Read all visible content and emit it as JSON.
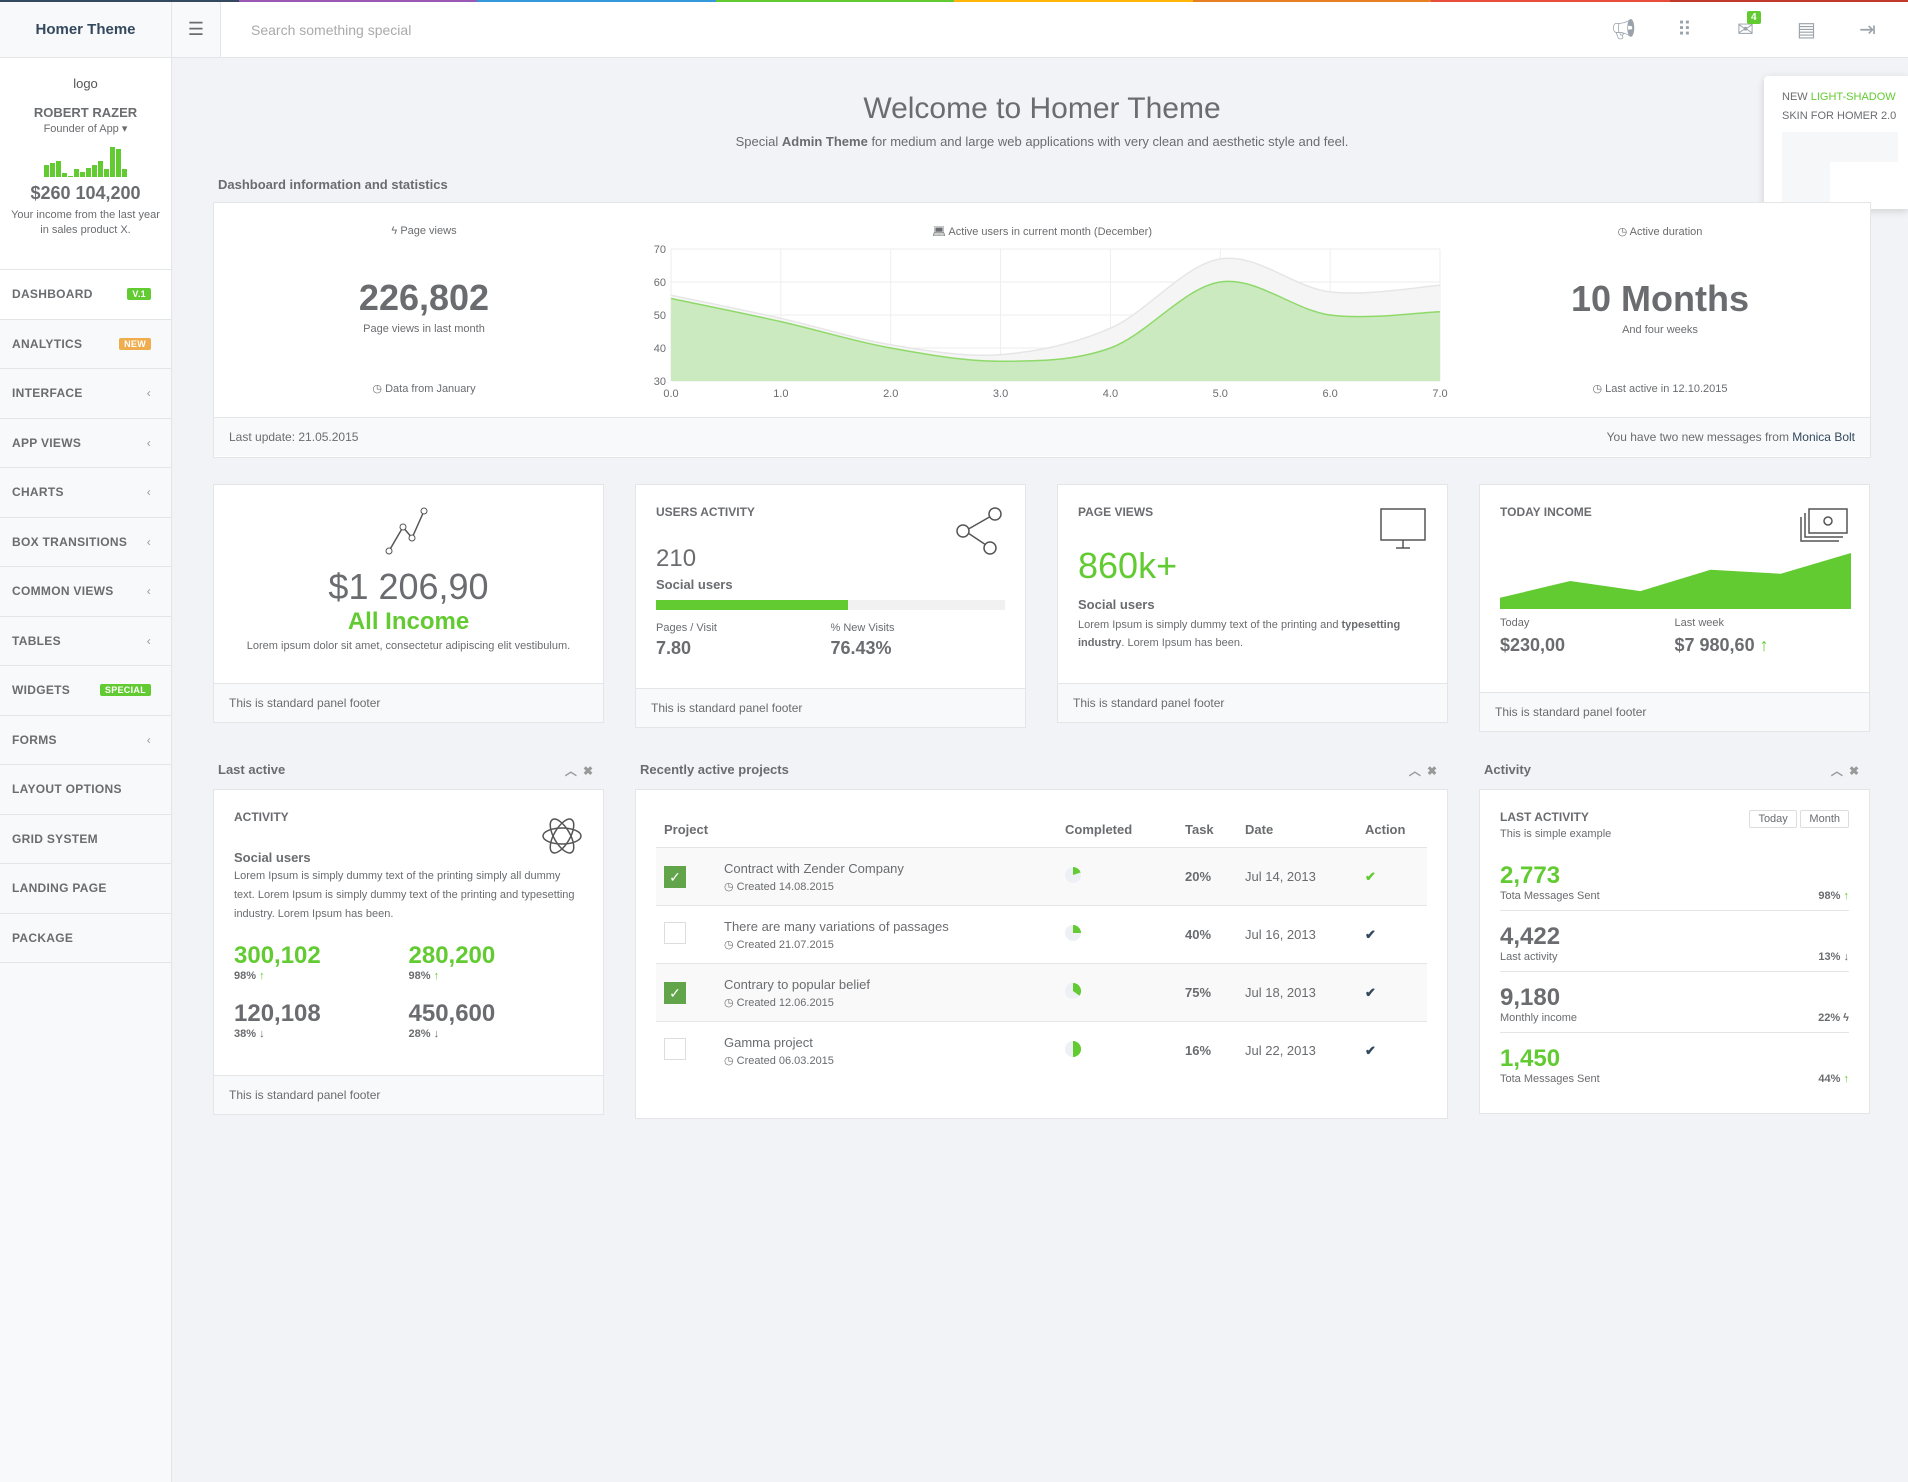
{
  "header": {
    "brand": "Homer Theme",
    "search_placeholder": "Search something special",
    "mail_count": "4",
    "stripe_colors": [
      "#34495e",
      "#9b59b6",
      "#3498db",
      "#62cb31",
      "#ffb606",
      "#e67e22",
      "#e74c3c",
      "#c0392b"
    ]
  },
  "profile": {
    "logo_alt": "logo",
    "name": "ROBERT RAZER",
    "role": "Founder of App",
    "spark": [
      12,
      14,
      16,
      4,
      1,
      8,
      5,
      9,
      12,
      16,
      8,
      30,
      28,
      8
    ],
    "income": "$260 104,200",
    "desc": "Your income from the last year in sales product X."
  },
  "nav": [
    {
      "label": "DASHBOARD",
      "badge": "V.1",
      "badge_color": "#62cb31"
    },
    {
      "label": "ANALYTICS",
      "badge": "NEW",
      "badge_color": "#f0ad4e"
    },
    {
      "label": "INTERFACE",
      "chevron": "‹"
    },
    {
      "label": "APP VIEWS",
      "chevron": "‹"
    },
    {
      "label": "CHARTS",
      "chevron": "‹"
    },
    {
      "label": "BOX TRANSITIONS",
      "chevron": "‹"
    },
    {
      "label": "COMMON VIEWS",
      "chevron": "‹"
    },
    {
      "label": "TABLES",
      "chevron": "‹"
    },
    {
      "label": "WIDGETS",
      "badge": "SPECIAL",
      "badge_color": "#62cb31"
    },
    {
      "label": "FORMS",
      "chevron": "‹"
    },
    {
      "label": "LAYOUT OPTIONS"
    },
    {
      "label": "GRID SYSTEM"
    },
    {
      "label": "LANDING PAGE"
    },
    {
      "label": "PACKAGE"
    }
  ],
  "promo": {
    "line1_prefix": "NEW ",
    "line1_highlight": "LIGHT-SHADOW",
    "line2": "SKIN FOR HOMER 2.0"
  },
  "welcome": {
    "title": "Welcome to Homer Theme",
    "sub_pre": "Special ",
    "sub_bold": "Admin Theme",
    "sub_post": " for medium and large web applications with very clean and aesthetic style and feel."
  },
  "dashboard": {
    "section_title": "Dashboard information and statistics",
    "left": {
      "label": "Page views",
      "value": "226,802",
      "sub": "Page views in last month",
      "bottom": "Data from January"
    },
    "right": {
      "label": "Active duration",
      "value": "10 Months",
      "sub": "And four weeks",
      "bottom": "Last active in 12.10.2015"
    },
    "footer_left": "Last update: 21.05.2015",
    "footer_right_pre": "You have two new messages from ",
    "footer_right_name": "Monica Bolt"
  },
  "chart_data": {
    "type": "area",
    "title": "Active users in current month (December)",
    "xlim": [
      0,
      7
    ],
    "ylim": [
      30,
      70
    ],
    "xticks": [
      "0.0",
      "1.0",
      "2.0",
      "3.0",
      "4.0",
      "5.0",
      "6.0",
      "7.0"
    ],
    "yticks": [
      "30",
      "40",
      "50",
      "60",
      "70"
    ],
    "grid": true,
    "x": [
      0,
      1,
      2,
      3,
      4,
      5,
      6,
      7
    ],
    "series": [
      {
        "color": "#e8e8e8",
        "values": [
          56,
          49,
          41,
          38,
          46,
          67,
          57,
          59
        ]
      },
      {
        "color": "#62cb31",
        "values": [
          55,
          48,
          40,
          36,
          40,
          60,
          50,
          51
        ]
      }
    ]
  },
  "cards": {
    "income": {
      "value": "$1 206,90",
      "label": "All Income",
      "text": "Lorem ipsum dolor sit amet, consectetur adipiscing elit vestibulum.",
      "footer": "This is standard panel footer"
    },
    "users": {
      "title": "USERS ACTIVITY",
      "value": "210",
      "label": "Social users",
      "progress": 55,
      "l1": "Pages / Visit",
      "v1": "7.80",
      "l2": "% New Visits",
      "v2": "76.43%",
      "footer": "This is standard panel footer"
    },
    "pageviews": {
      "title": "PAGE VIEWS",
      "value": "860k+",
      "label": "Social users",
      "text_pre": "Lorem Ipsum is simply dummy text of the printing and ",
      "text_bold": "typesetting industry",
      "text_post": ". Lorem Ipsum has been.",
      "footer": "This is standard panel footer"
    },
    "today": {
      "title": "TODAY INCOME",
      "spark": [
        20,
        50,
        32,
        70,
        63,
        100
      ],
      "l1": "Today",
      "v1": "$230,00",
      "l2": "Last week",
      "v2": "$7 980,60",
      "footer": "This is standard panel footer"
    }
  },
  "last_active": {
    "heading": "Last active",
    "title": "ACTIVITY",
    "sub": "Social users",
    "text": "Lorem Ipsum is simply dummy text of the printing simply all dummy text. Lorem Ipsum is simply dummy text of the printing and typesetting industry. Lorem Ipsum has been.",
    "stats": [
      {
        "v": "300,102",
        "p": "98%",
        "dir": "up"
      },
      {
        "v": "280,200",
        "p": "98%",
        "dir": "up"
      },
      {
        "v": "120,108",
        "p": "38%",
        "dir": "down"
      },
      {
        "v": "450,600",
        "p": "28%",
        "dir": "down"
      }
    ],
    "footer": "This is standard panel footer"
  },
  "projects": {
    "heading": "Recently active projects",
    "columns": [
      "Project",
      "Completed",
      "Task",
      "Date",
      "Action"
    ],
    "rows": [
      {
        "checked": true,
        "name": "Contract with Zender Company",
        "created": "Created 14.08.2015",
        "pie": 20,
        "task": "20%",
        "date": "Jul 14, 2013",
        "action_color": "#62cb31"
      },
      {
        "checked": false,
        "name": "There are many variations of passages",
        "created": "Created 21.07.2015",
        "pie": 25,
        "task": "40%",
        "date": "Jul 16, 2013",
        "action_color": "#34495e"
      },
      {
        "checked": true,
        "name": "Contrary to popular belief",
        "created": "Created 12.06.2015",
        "pie": 35,
        "task": "75%",
        "date": "Jul 18, 2013",
        "action_color": "#34495e"
      },
      {
        "checked": false,
        "name": "Gamma project",
        "created": "Created 06.03.2015",
        "pie": 50,
        "task": "16%",
        "date": "Jul 22, 2013",
        "action_color": "#34495e"
      }
    ]
  },
  "activity": {
    "heading": "Activity",
    "title": "LAST ACTIVITY",
    "sub": "This is simple example",
    "btn_today": "Today",
    "btn_month": "Month",
    "rows": [
      {
        "v": "2,773",
        "label": "Tota Messages Sent",
        "p": "98%",
        "icon": "up",
        "green": true
      },
      {
        "v": "4,422",
        "label": "Last activity",
        "p": "13%",
        "icon": "down",
        "green": false
      },
      {
        "v": "9,180",
        "label": "Monthly income",
        "p": "22%",
        "icon": "bolt",
        "green": false
      },
      {
        "v": "1,450",
        "label": "Tota Messages Sent",
        "p": "44%",
        "icon": "up",
        "green": true
      }
    ]
  }
}
